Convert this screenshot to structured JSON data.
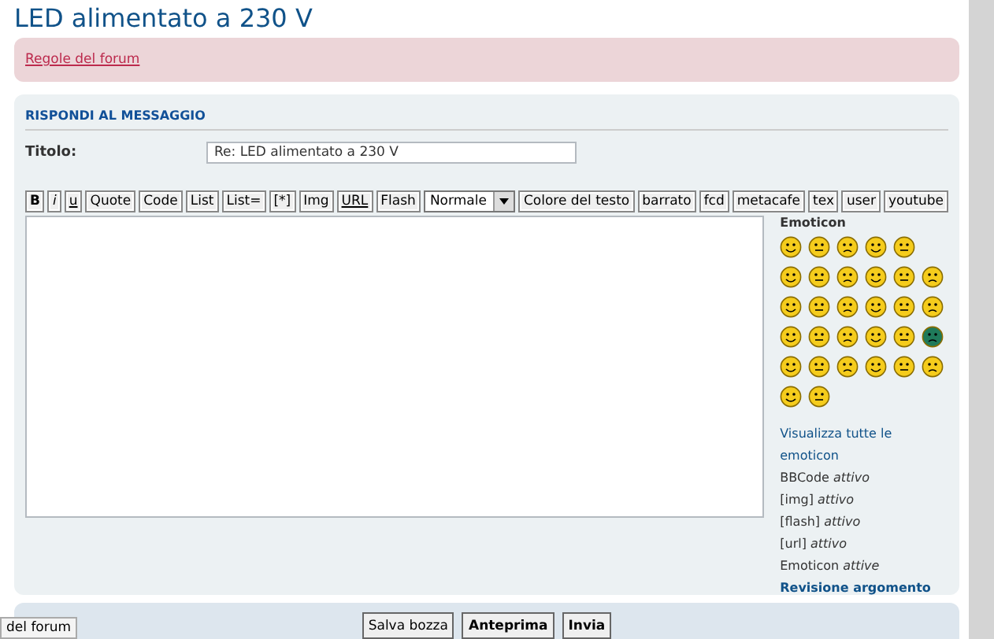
{
  "title": "LED alimentato a 230 V",
  "notice": {
    "link": "Regole del forum"
  },
  "post": {
    "heading": "RISPONDI AL MESSAGGIO",
    "subject_label": "Titolo:",
    "subject_value": "Re: LED alimentato a 230 V",
    "toolbar": [
      {
        "kind": "button",
        "label": "B"
      },
      {
        "kind": "button",
        "label": "i"
      },
      {
        "kind": "button",
        "label": "u"
      },
      {
        "kind": "button",
        "label": "Quote"
      },
      {
        "kind": "button",
        "label": "Code"
      },
      {
        "kind": "button",
        "label": "List"
      },
      {
        "kind": "button",
        "label": "List="
      },
      {
        "kind": "button",
        "label": "[*]"
      },
      {
        "kind": "button",
        "label": "Img"
      },
      {
        "kind": "button",
        "label": "URL"
      },
      {
        "kind": "button",
        "label": "Flash"
      },
      {
        "kind": "select",
        "label": "Normale"
      },
      {
        "kind": "button",
        "label": "Colore del testo"
      },
      {
        "kind": "button",
        "label": "barrato"
      },
      {
        "kind": "button",
        "label": "fcd"
      },
      {
        "kind": "button",
        "label": "metacafe"
      },
      {
        "kind": "button",
        "label": "tex"
      },
      {
        "kind": "button",
        "label": "user"
      },
      {
        "kind": "button",
        "label": "youtube"
      }
    ],
    "sidebar": {
      "heading": "Emoticon",
      "view_all_link": "Visualizza tutte le emoticon",
      "status_lines": [
        "BBCode *attivo*",
        "[img] *attivo*",
        "[flash] *attivo*",
        "[url] *attivo*",
        "Emoticon *attive*"
      ],
      "review_link": "Revisione argomento"
    }
  },
  "actions": [
    {
      "label": "Salva bozza",
      "primary": false
    },
    {
      "label": "Anteprima",
      "primary": true
    },
    {
      "label": "Invia",
      "primary": true
    }
  ],
  "status_tooltip": "del forum"
}
